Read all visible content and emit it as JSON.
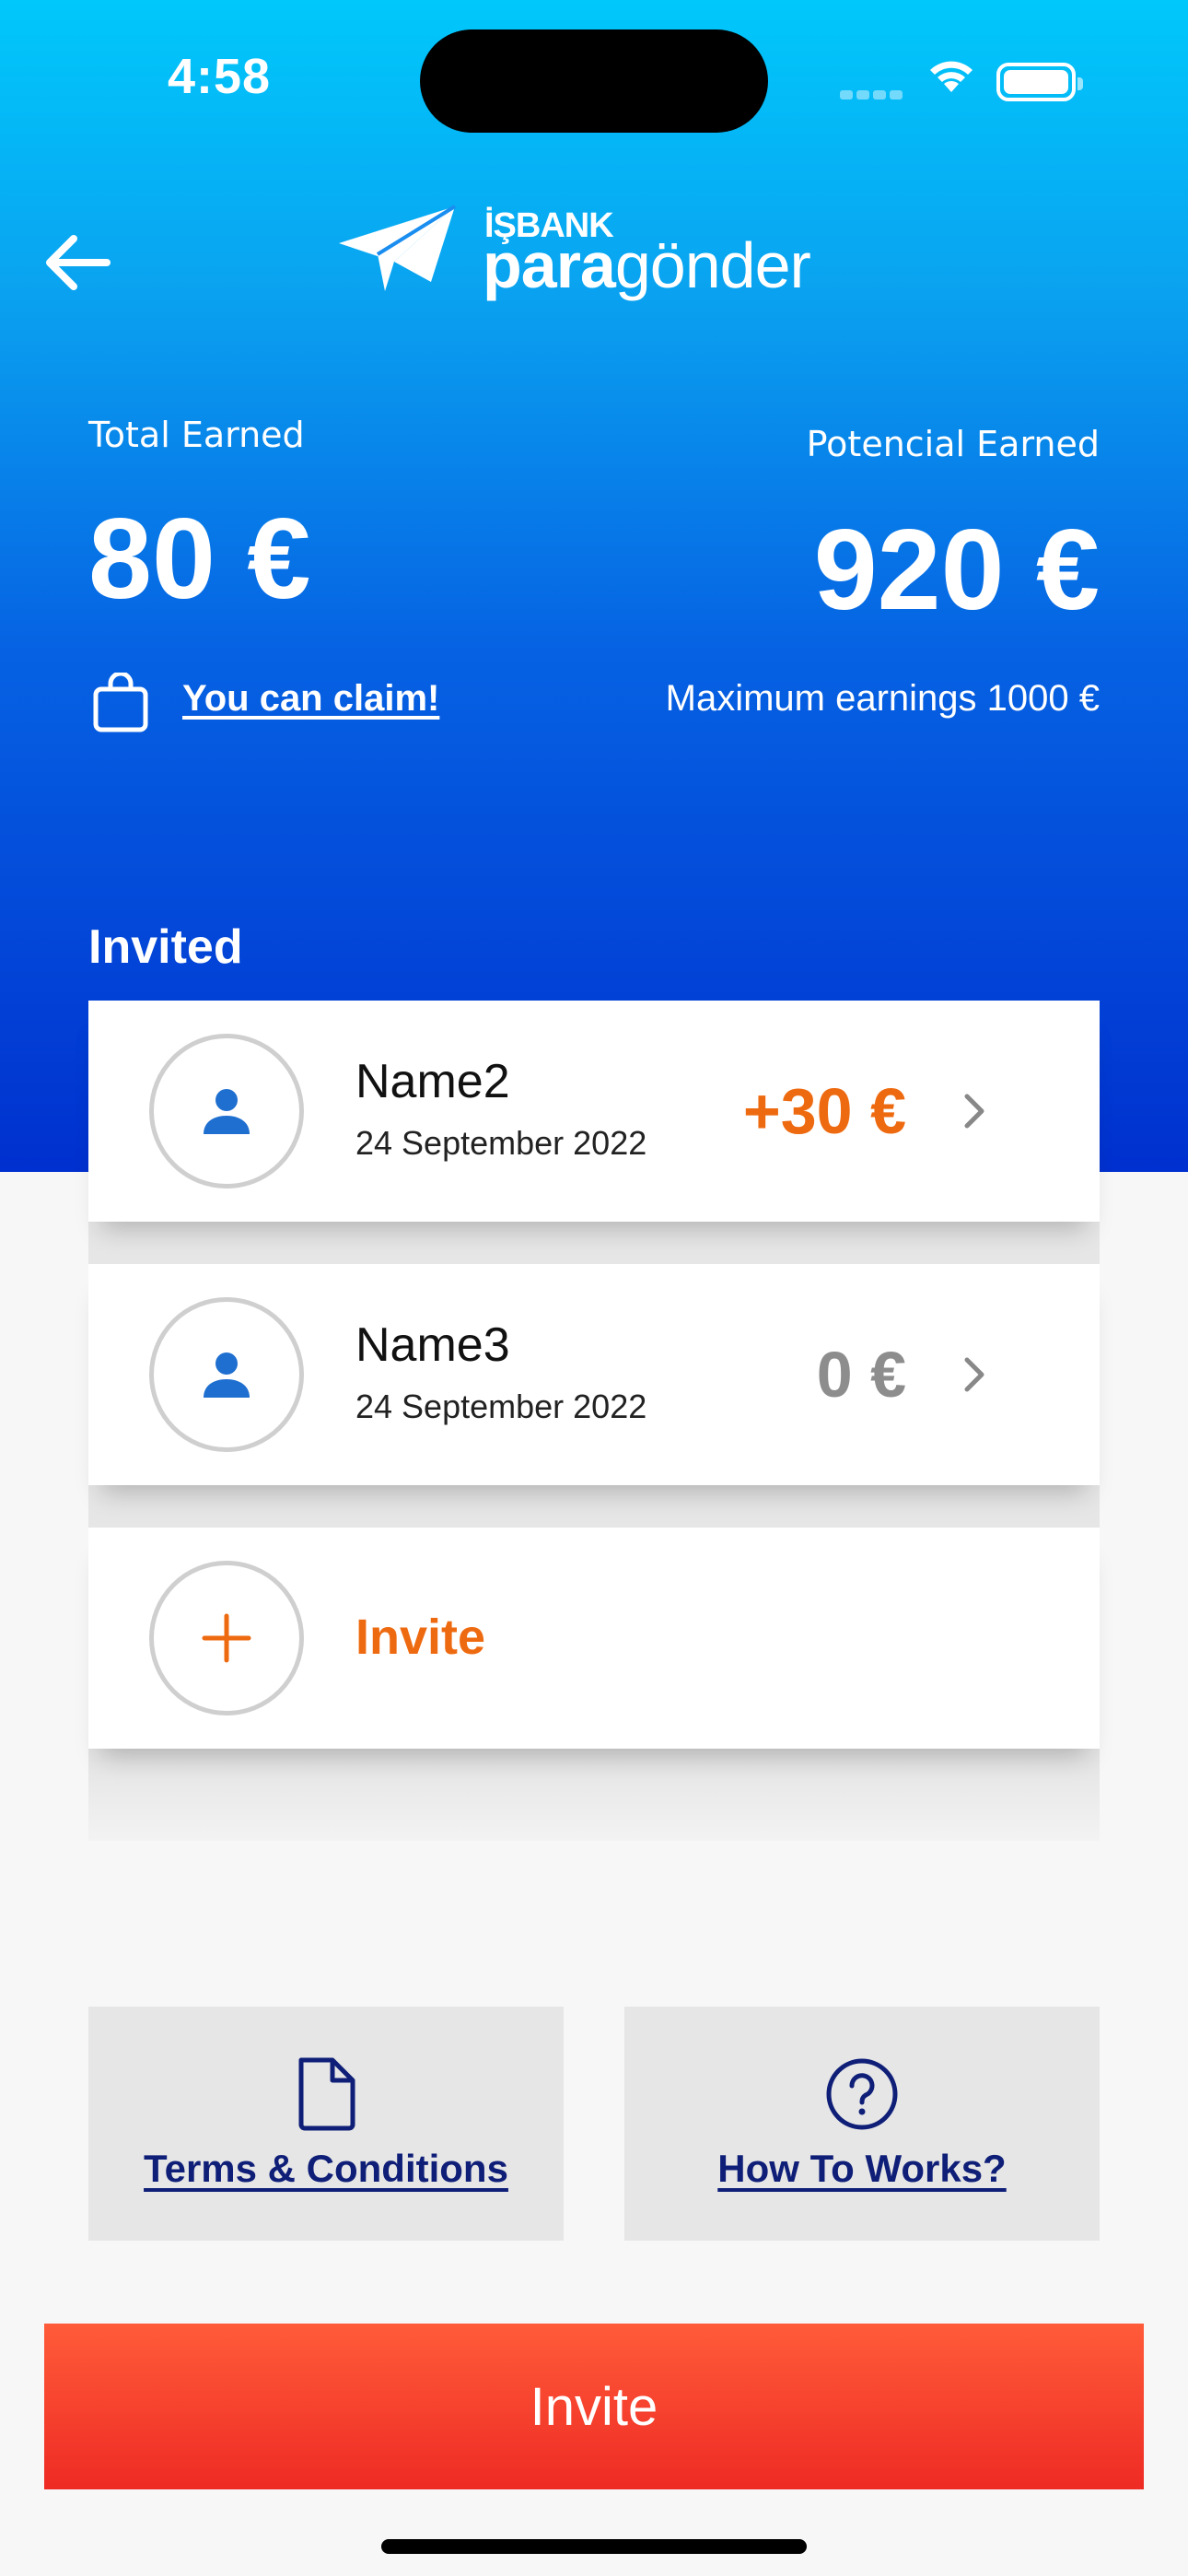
{
  "status_bar": {
    "time": "4:58"
  },
  "header": {
    "logo_bank": "İŞBANK",
    "logo_para": "para",
    "logo_gonder": "gönder",
    "back_icon": "arrow-left-icon"
  },
  "earnings": {
    "total_label": "Total Earned",
    "total_value": "80 €",
    "potential_label": "Potencial Earned",
    "potential_value": "920 €",
    "claim_link": "You can claim!",
    "max_earnings": "Maximum earnings 1000 €"
  },
  "invited": {
    "title": "Invited",
    "items": [
      {
        "name": "Name2",
        "date": "24 September 2022",
        "amount": "+30 €",
        "amount_color": "#ee6a10"
      },
      {
        "name": "Name3",
        "date": "24 September 2022",
        "amount": "0 €",
        "amount_color": "#8d8d8d"
      }
    ],
    "invite_label": "Invite"
  },
  "links": {
    "terms": "Terms & Conditions",
    "how": "How To Works?"
  },
  "cta": {
    "invite": "Invite"
  },
  "colors": {
    "accent_orange": "#ee6a10",
    "link_navy": "#0f1f78",
    "cta_red": "#ee2b24",
    "hero_blue": "#0663e3"
  }
}
